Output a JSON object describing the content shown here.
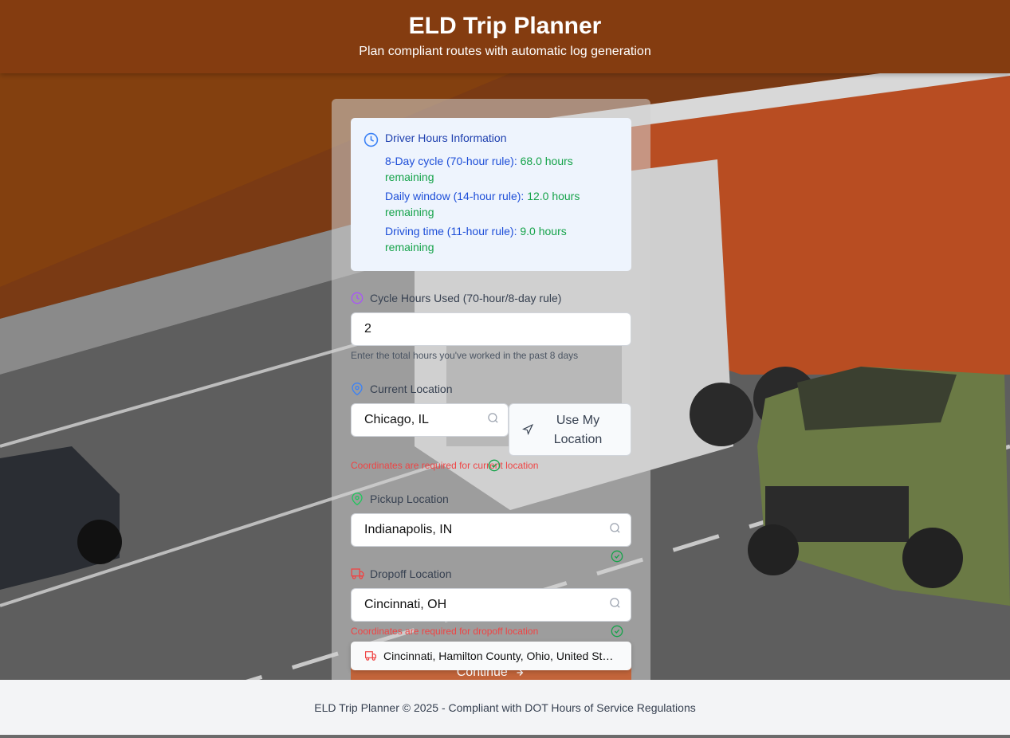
{
  "header": {
    "title": "ELD Trip Planner",
    "subtitle": "Plan compliant routes with automatic log generation"
  },
  "info": {
    "title": "Driver Hours Information",
    "cycle_label": "8-Day cycle (70-hour rule):",
    "cycle_value": "68.0 hours remaining",
    "daily_label": "Daily window (14-hour rule):",
    "daily_value": "12.0 hours remaining",
    "driving_label": "Driving time (11-hour rule):",
    "driving_value": "9.0 hours remaining"
  },
  "cycle": {
    "label": "Cycle Hours Used (70-hour/8-day rule)",
    "value": "2",
    "help": "Enter the total hours you've worked in the past 8 days"
  },
  "current": {
    "label": "Current Location",
    "value": "Chicago, IL",
    "button_label": "Use My Location",
    "error": "Coordinates are required for current location"
  },
  "pickup": {
    "label": "Pickup Location",
    "value": "Indianapolis, IN"
  },
  "dropoff": {
    "label": "Dropoff Location",
    "value": "Cincinnati, OH",
    "error": "Coordinates are required for dropoff location",
    "suggestion": "Cincinnati, Hamilton County, Ohio, United States"
  },
  "continue_label": "Continue",
  "footer": "ELD Trip Planner © 2025 - Compliant with DOT Hours of Service Regulations",
  "colors": {
    "header": "#843c10",
    "accent_blue": "#1d4ed8",
    "success": "#16a34a",
    "error": "#ef4444",
    "continue": "#c2643a"
  }
}
